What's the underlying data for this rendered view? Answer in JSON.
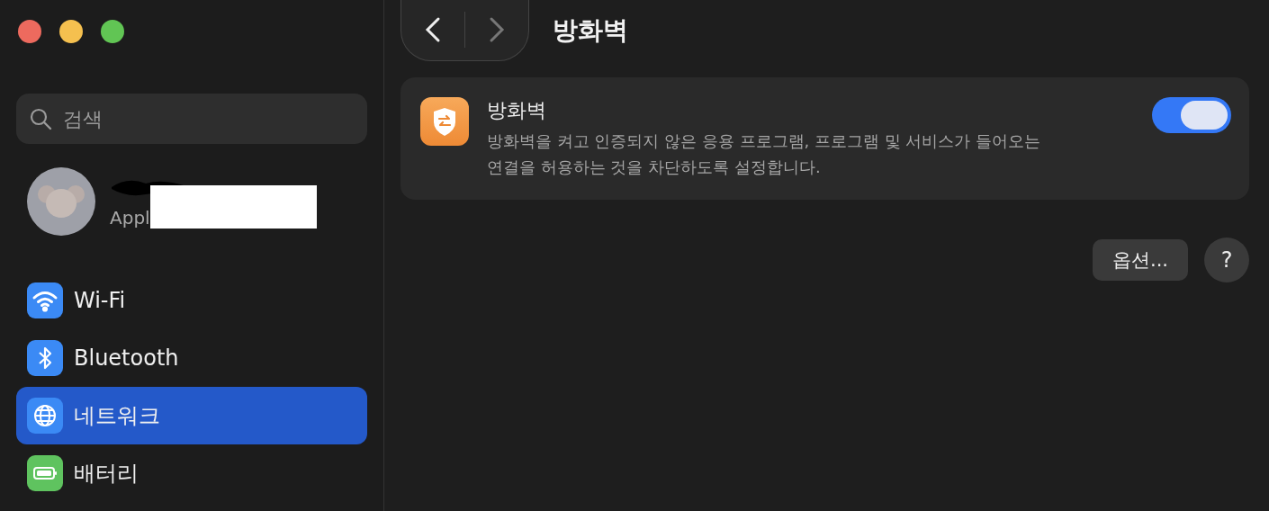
{
  "sidebar": {
    "search": {
      "placeholder": "검색"
    },
    "account": {
      "subtitle": "Appl"
    },
    "items": [
      {
        "label": "Wi-Fi",
        "kind": "wifi",
        "color": "#3b8af5",
        "selected": false
      },
      {
        "label": "Bluetooth",
        "kind": "bluetooth",
        "color": "#3b8af5",
        "selected": false
      },
      {
        "label": "네트워크",
        "kind": "network",
        "color": "#3b8af5",
        "selected": true
      },
      {
        "label": "배터리",
        "kind": "battery",
        "color": "#5fc35f",
        "selected": false
      }
    ]
  },
  "toolbar": {
    "back": {
      "disabled": false
    },
    "forward": {
      "disabled": true
    },
    "title": "방화벽"
  },
  "firewall": {
    "title": "방화벽",
    "description": "방화벽을 켜고 인증되지 않은 응용 프로그램, 프로그램 및 서비스가 들어오는 연결을 허용하는 것을 차단하도록 설정합니다.",
    "on": true
  },
  "buttons": {
    "options": "옵션...",
    "help": "?"
  }
}
